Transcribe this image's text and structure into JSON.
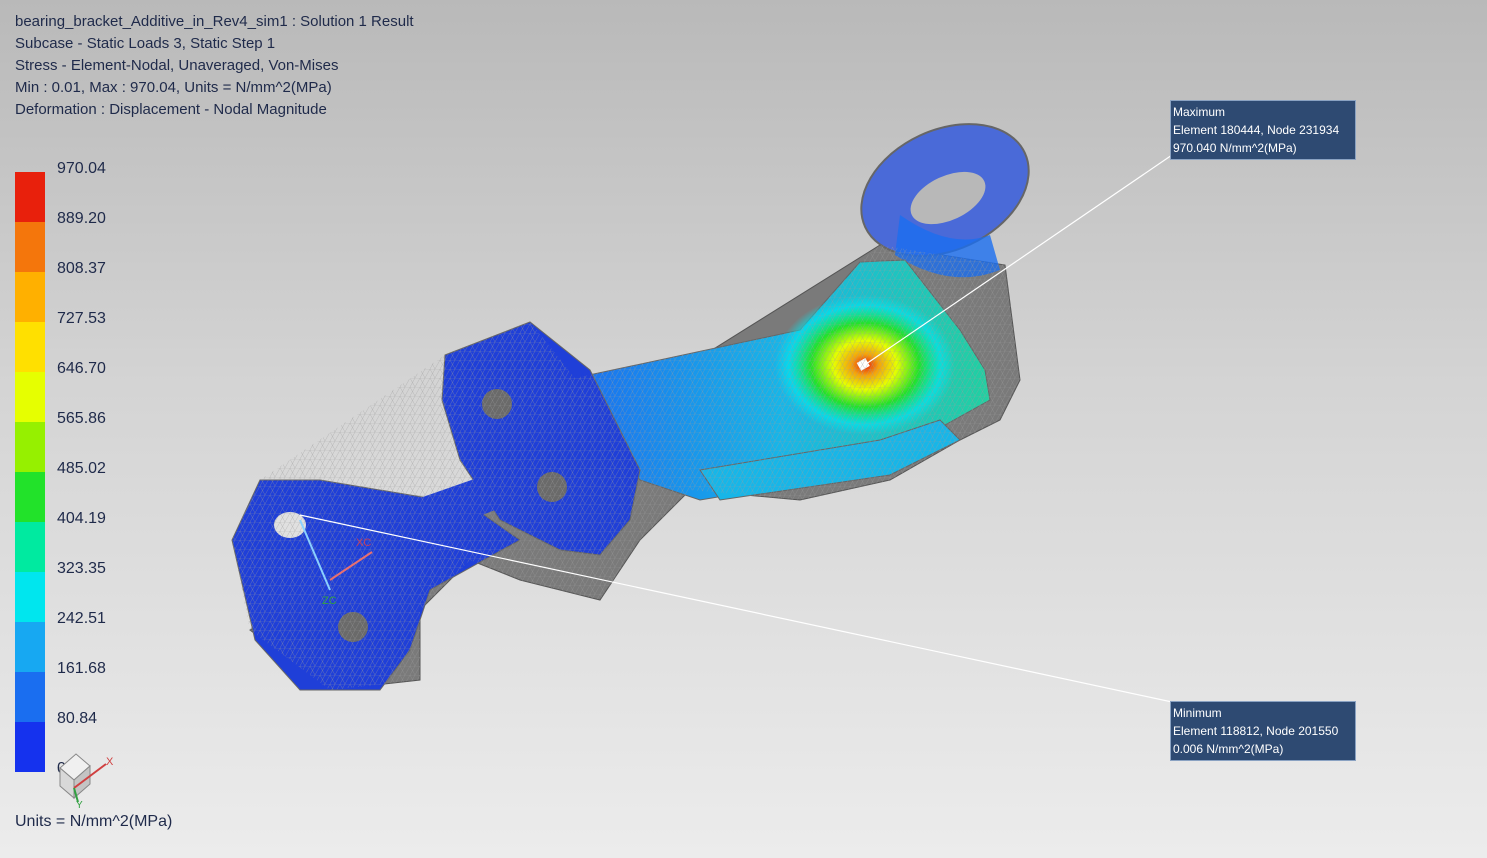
{
  "header": {
    "line1": "bearing_bracket_Additive_in_Rev4_sim1 : Solution 1 Result",
    "line2": "Subcase - Static Loads 3, Static Step 1",
    "line3": "Stress - Element-Nodal, Unaveraged, Von-Mises",
    "line4": "Min : 0.01, Max : 970.04, Units = N/mm^2(MPa)",
    "line5": "Deformation : Displacement - Nodal Magnitude"
  },
  "legend": {
    "values": [
      "970.04",
      "889.20",
      "808.37",
      "727.53",
      "646.70",
      "565.86",
      "485.02",
      "404.19",
      "323.35",
      "242.51",
      "161.68",
      "80.84",
      "0.01"
    ],
    "colors": [
      "#e8200c",
      "#f4760c",
      "#ffb000",
      "#ffe000",
      "#e6ff00",
      "#96f000",
      "#22e22a",
      "#00eaa0",
      "#00e6ee",
      "#17a8f2",
      "#1a6ef0",
      "#1532ee"
    ]
  },
  "units_footer": "Units = N/mm^2(MPa)",
  "max_callout": {
    "line1": "Maximum",
    "line2": "Element 180444, Node 231934",
    "line3": "970.040 N/mm^2(MPa)"
  },
  "min_callout": {
    "line1": "Minimum",
    "line2": "Element 118812, Node 201550",
    "line3": "0.006 N/mm^2(MPa)"
  },
  "triad": {
    "x_label": "X",
    "y_label": "Y",
    "z_label": "ZC",
    "xc_label": "XC"
  },
  "colors": {
    "mesh_base": "#1f3fd8",
    "mesh_edge": "#6b6b6b",
    "text": "#1f2a4a",
    "callout_bg": "#2e4a72"
  }
}
